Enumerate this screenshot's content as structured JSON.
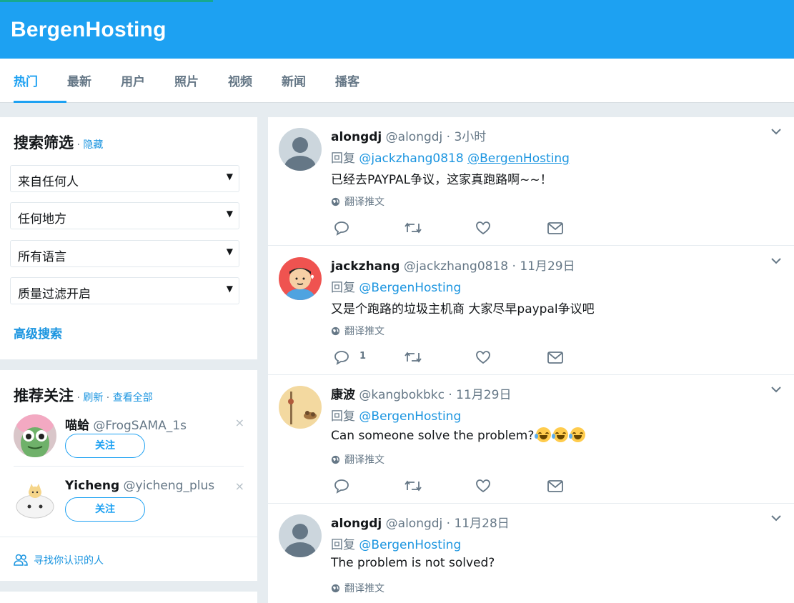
{
  "brand": "BergenHosting",
  "tabs": [
    {
      "label": "热门",
      "active": true
    },
    {
      "label": "最新"
    },
    {
      "label": "用户"
    },
    {
      "label": "照片"
    },
    {
      "label": "视频"
    },
    {
      "label": "新闻"
    },
    {
      "label": "播客"
    }
  ],
  "filters": {
    "title": "搜索筛选",
    "sep": " · ",
    "hide": "隐藏",
    "selects": [
      "来自任何人",
      "任何地方",
      "所有语言",
      "质量过滤开启"
    ],
    "advanced": "高级搜索"
  },
  "follow": {
    "title": "推荐关注",
    "sep1": " · ",
    "refresh": "刷新",
    "sep2": " · ",
    "view_all": "查看全部",
    "users": [
      {
        "name": "喵蛤",
        "handle": "@FrogSAMA_1s",
        "button": "关注",
        "close": "×"
      },
      {
        "name": "Yicheng",
        "handle": "@yicheng_plus",
        "button": "关注",
        "close": "×"
      }
    ],
    "find_people": "寻找你认识的人"
  },
  "tweets": [
    {
      "name": "alongdj",
      "handle": "@alongdj",
      "time": " · 3小时",
      "reply_prefix": "回复 ",
      "reply_to": [
        "@jackzhang0818",
        "@BergenHosting"
      ],
      "text": "已经去PAYPAL争议，这家真跑路啊~~！",
      "translate": "翻译推文",
      "reply_count": "",
      "emoji_count": 0
    },
    {
      "name": "jackzhang",
      "handle": "@jackzhang0818",
      "time": " · 11月29日",
      "reply_prefix": "回复 ",
      "reply_to": [
        "@BergenHosting"
      ],
      "text": "又是个跑路的垃圾主机商 大家尽早paypal争议吧",
      "translate": "翻译推文",
      "reply_count": "1",
      "emoji_count": 0
    },
    {
      "name": "康波",
      "handle": "@kangbokbkc",
      "time": " · 11月29日",
      "reply_prefix": "回复 ",
      "reply_to": [
        "@BergenHosting"
      ],
      "text": "Can someone solve the problem?",
      "translate": "翻译推文",
      "reply_count": "",
      "emoji_count": 3
    },
    {
      "name": "alongdj",
      "handle": "@alongdj",
      "time": " · 11月28日",
      "reply_prefix": "回复 ",
      "reply_to": [
        "@BergenHosting"
      ],
      "text": "The problem is not solved?",
      "translate": "翻译推文",
      "reply_count": "",
      "emoji_count": 0
    }
  ],
  "colors": {
    "brand_blue": "#1da1f2",
    "link_blue": "#1b95e0",
    "muted": "#657786",
    "bg": "#e6ecf0"
  },
  "icons": [
    "reply-icon",
    "retweet-icon",
    "like-icon",
    "message-icon",
    "globe-icon",
    "chevron-down-icon",
    "people-icon",
    "close-icon"
  ]
}
